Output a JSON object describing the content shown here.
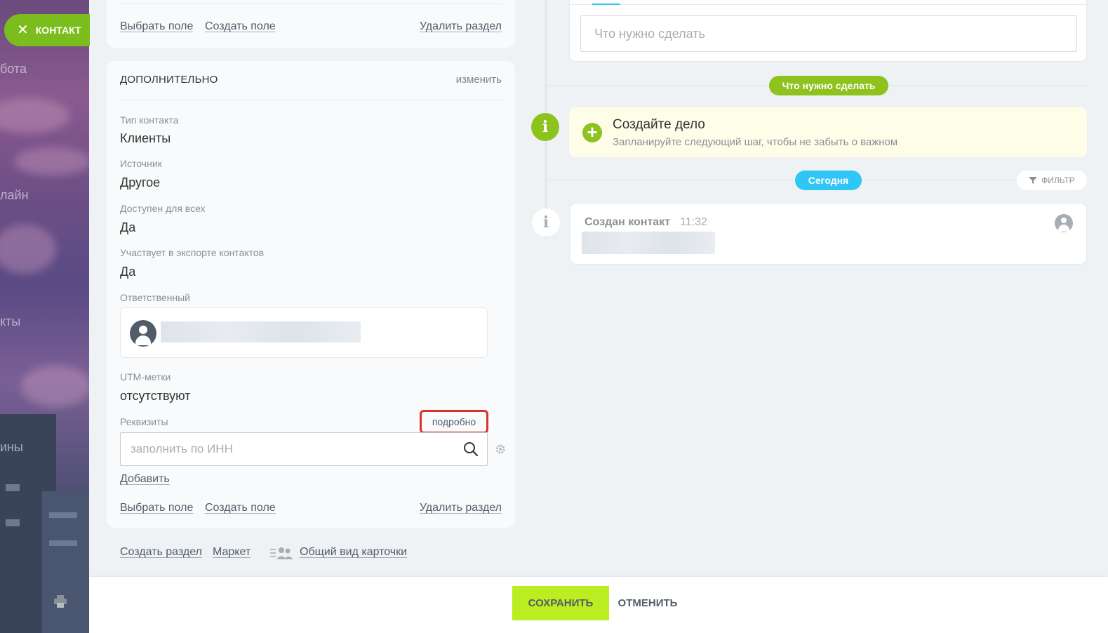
{
  "sidebar": {
    "contact_button": "КОНТАКТ",
    "fragments": [
      "бота",
      "лайн",
      "кты",
      "ины"
    ]
  },
  "top_card": {
    "select_field": "Выбрать поле",
    "create_field": "Создать поле",
    "delete_section": "Удалить раздел"
  },
  "extra_section": {
    "title": "ДОПОЛНИТЕЛЬНО",
    "edit": "изменить",
    "fields": [
      {
        "label": "Тип контакта",
        "value": "Клиенты"
      },
      {
        "label": "Источник",
        "value": "Другое"
      },
      {
        "label": "Доступен для всех",
        "value": "Да"
      },
      {
        "label": "Участвует в экспорте контактов",
        "value": "Да"
      }
    ],
    "responsible_label": "Ответственный",
    "utm_label": "UTM-метки",
    "utm_value": "отсутствуют",
    "requisites_label": "Реквизиты",
    "details_button": "подробно",
    "inn_placeholder": "заполнить по ИНН",
    "add_link": "Добавить",
    "select_field": "Выбрать поле",
    "create_field": "Создать поле",
    "delete_section": "Удалить раздел"
  },
  "bottom_links": {
    "create_section": "Создать раздел",
    "market": "Маркет",
    "card_view": "Общий вид карточки"
  },
  "timeline": {
    "task_placeholder": "Что нужно сделать",
    "todo_pill": "Что нужно сделать",
    "create_title": "Создайте дело",
    "create_subtitle": "Запланируйте следующий шаг, чтобы не забыть о важном",
    "today_pill": "Сегодня",
    "filter": "ФИЛЬТР",
    "event_title": "Создан контакт",
    "event_time": "11:32"
  },
  "footer": {
    "save": "СОХРАНИТЬ",
    "cancel": "ОТМЕНИТЬ"
  },
  "colors": {
    "accent_green": "#8ec21c",
    "save_green": "#bbed21",
    "today_blue": "#2fc6f6",
    "highlight_red": "#d8322f"
  }
}
